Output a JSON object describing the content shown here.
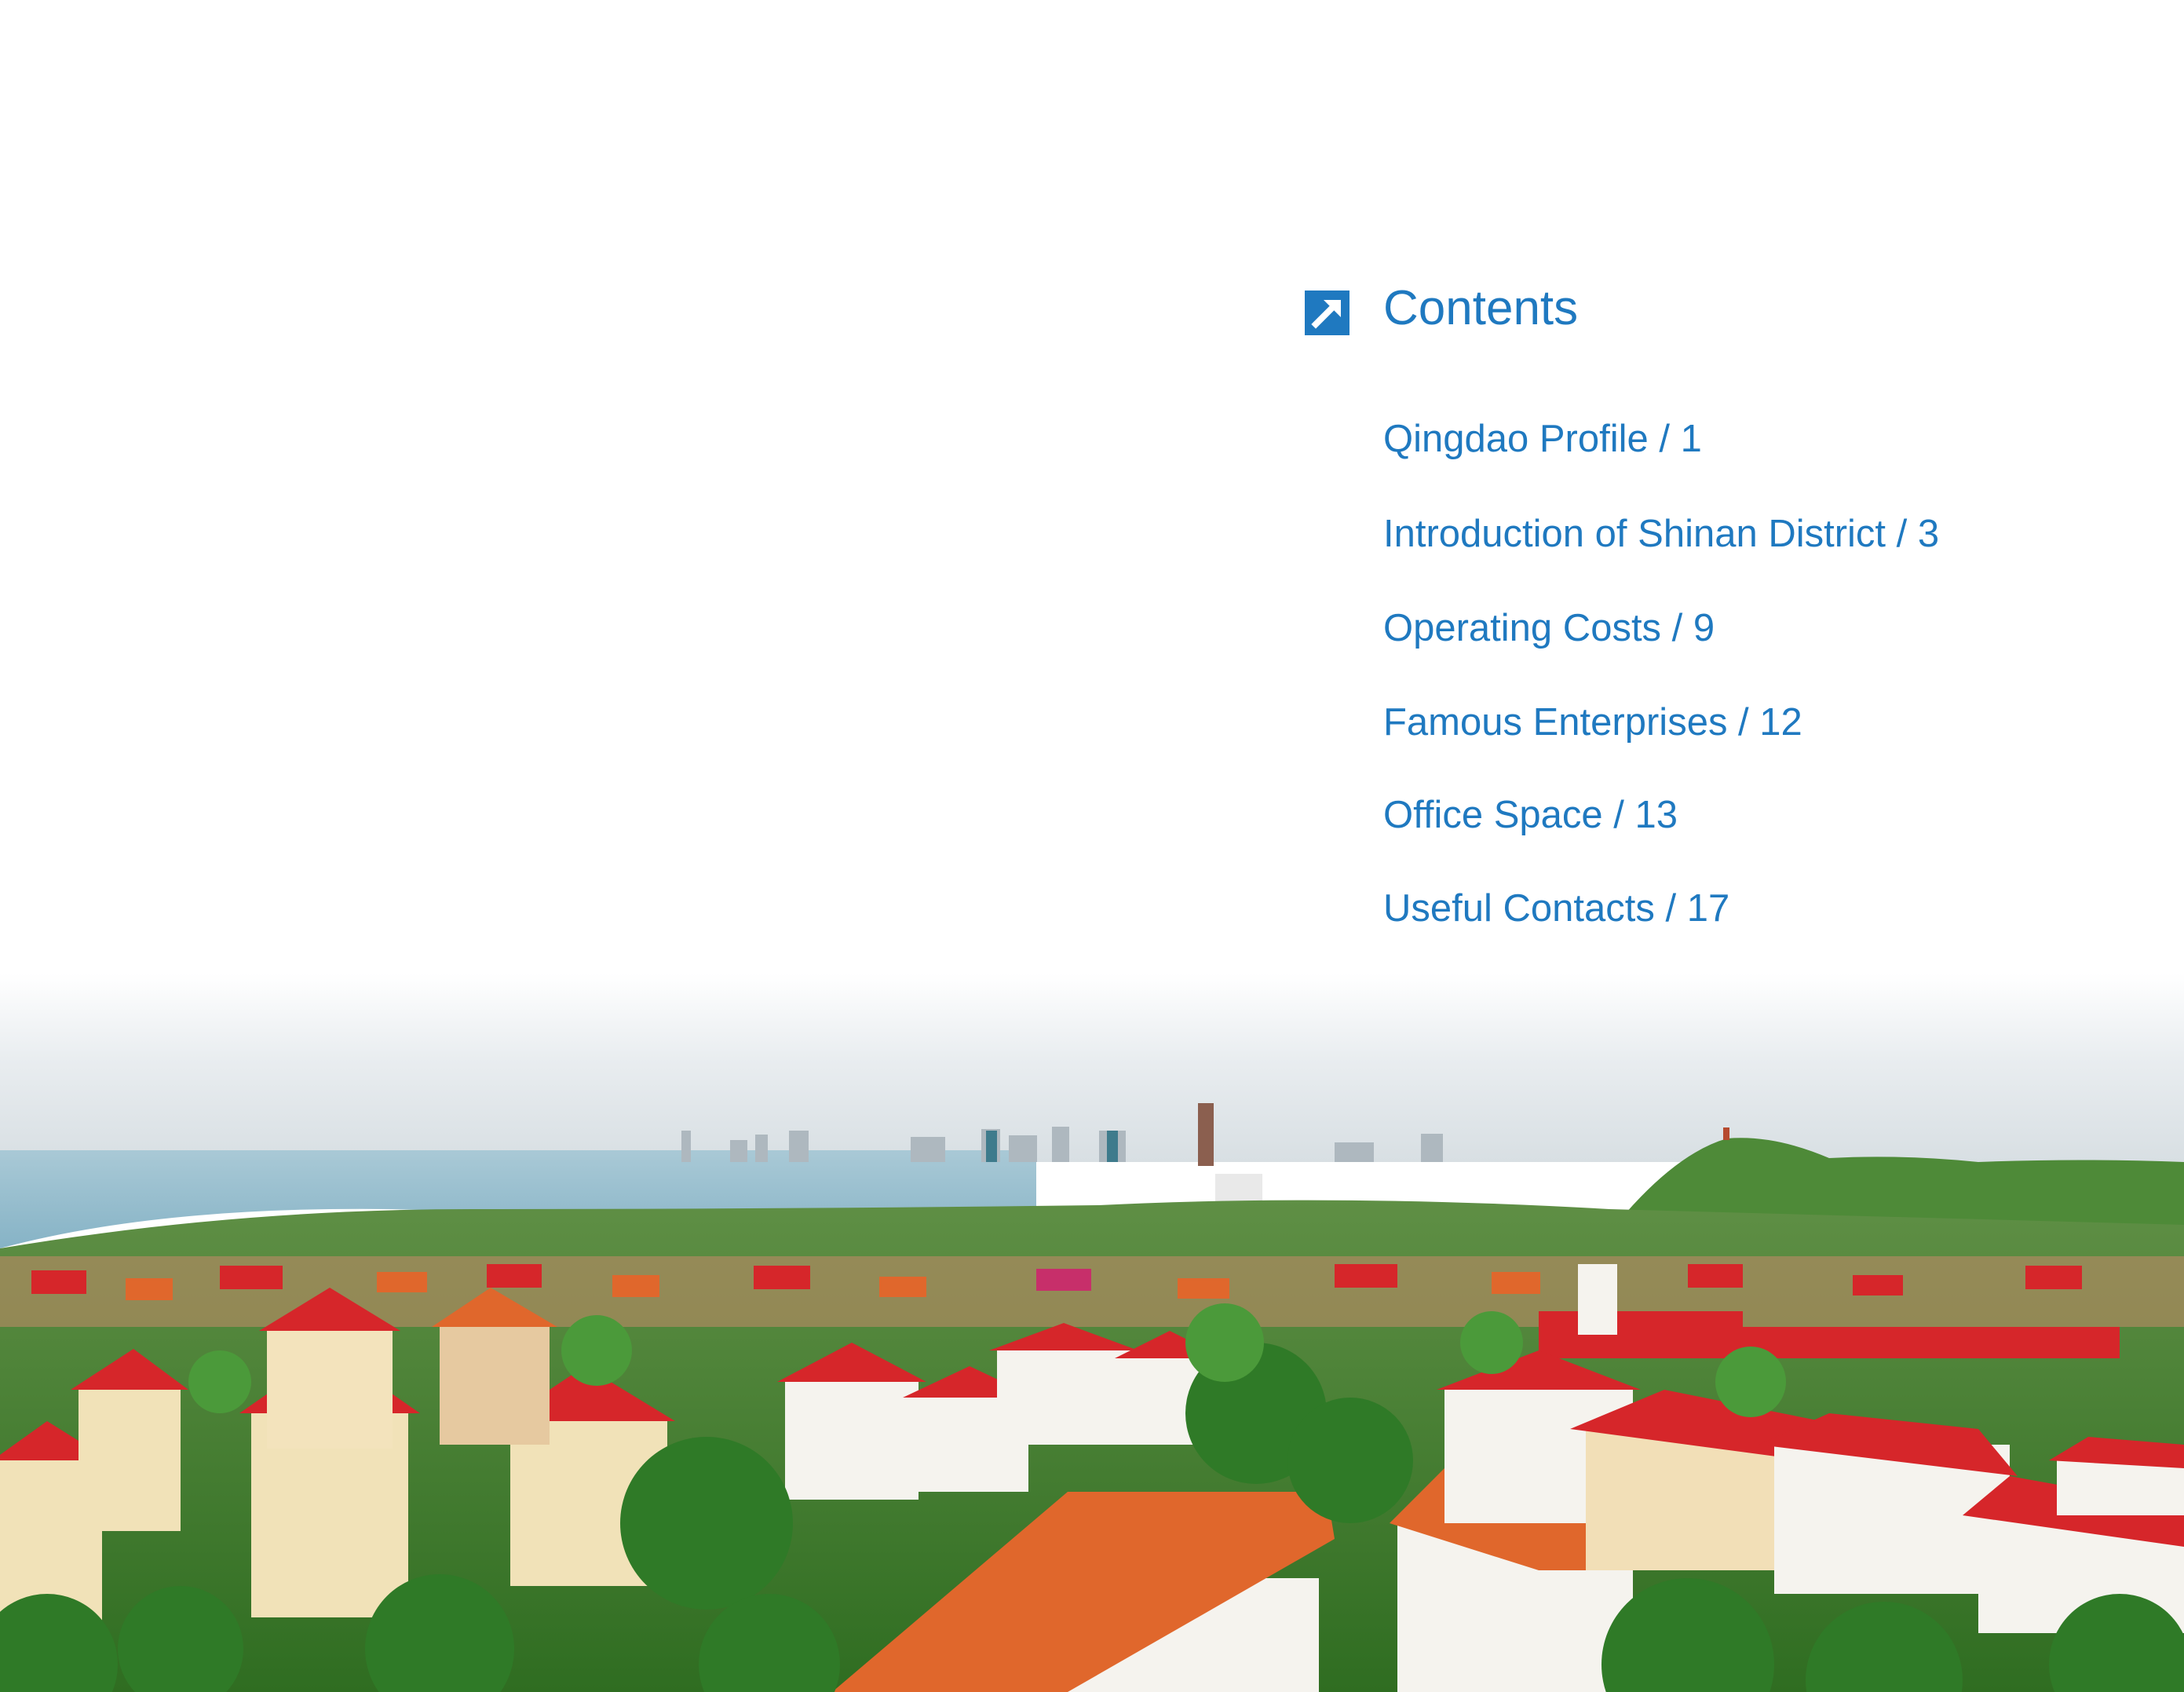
{
  "contents": {
    "title": "Contents",
    "items": [
      {
        "label": "Qingdao Profile / 1"
      },
      {
        "label": "Introduction of Shinan District / 3"
      },
      {
        "label": "Operating Costs / 9"
      },
      {
        "label": "Famous Enterprises / 12"
      },
      {
        "label": "Office Space / 13"
      },
      {
        "label": "Useful Contacts / 17"
      }
    ]
  },
  "icon": "arrow-up-right-icon",
  "colors": {
    "accent": "#1f79c0",
    "roof_red": "#d6262a",
    "roof_orange": "#e0672c",
    "foliage": "#3f8a2c",
    "sea": "#9fc3d1"
  }
}
